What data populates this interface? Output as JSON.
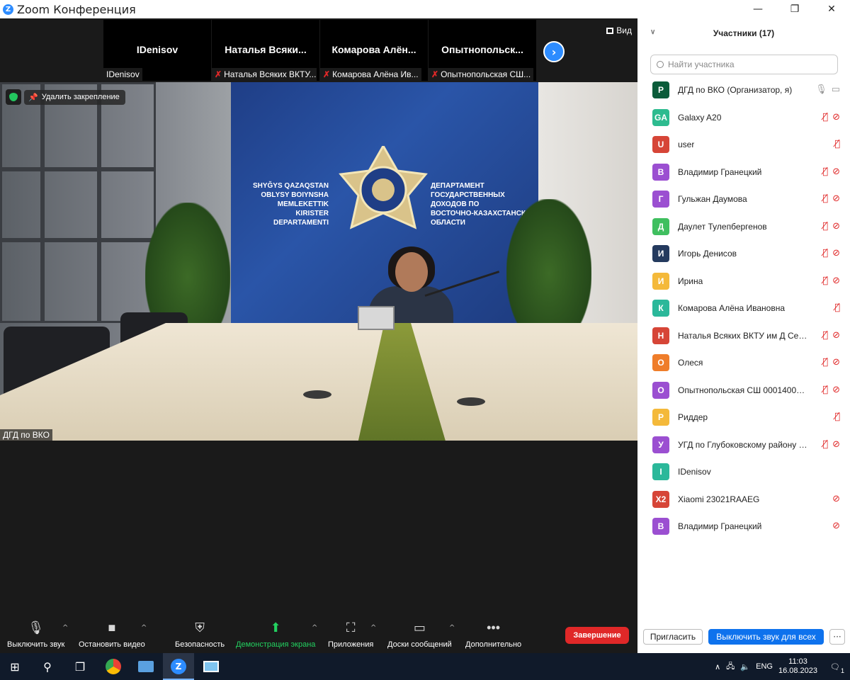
{
  "window": {
    "title": "Zoom Конференция",
    "controls": [
      "—",
      "❐",
      "✕"
    ]
  },
  "strip": {
    "tiles": [
      {
        "name": "IDenisov",
        "label": "IDenisov",
        "muted": false
      },
      {
        "name": "Наталья  Всяки...",
        "label": "Наталья Всяких ВКТУ...",
        "muted": true
      },
      {
        "name": "Комарова  Алён...",
        "label": "Комарова Алёна Ив...",
        "muted": true
      },
      {
        "name": "Опытнопольск...",
        "label": "Опытнопольская СШ...",
        "muted": true
      }
    ],
    "view_label": "Вид"
  },
  "main_video": {
    "unpin_label": "Удалить закрепление",
    "speaker_label": "ДГД по ВКО",
    "wall_text_left": [
      "SHYĞYS QAZAQSTAN",
      "OBLYSY BOIYNSHA",
      "MEMLEKETTIK",
      "KIRISTER",
      "DEPARTAMENTI"
    ],
    "wall_text_right": [
      "ДЕПАРТАМЕНТ",
      "ГОСУДАРСТВЕННЫХ",
      "ДОХОДОВ ПО",
      "ВОСТОЧНО-КАЗАХСТАНСКОЙ",
      "ОБЛАСТИ"
    ]
  },
  "toolbar": {
    "mute": "Выключить звук",
    "video": "Остановить видео",
    "security": "Безопасность",
    "share": "Демонстрация экрана",
    "apps": "Приложения",
    "boards": "Доски сообщений",
    "more": "Дополнительно",
    "end": "Завершение"
  },
  "panel": {
    "title": "Участники (17)",
    "search_placeholder": "Найти участника",
    "invite": "Пригласить",
    "mute_all": "Выключить звук для всех",
    "more": "···",
    "participants": [
      {
        "initials": "Р",
        "name": "ДГД по ВКО (Организатор, я)",
        "color": "#0b5c3a",
        "mic": "on",
        "cam": "on"
      },
      {
        "initials": "GA",
        "name": "Galaxy A20",
        "color": "#2dbb8f",
        "mic": "off",
        "cam": "off"
      },
      {
        "initials": "U",
        "name": "user",
        "color": "#d64537",
        "mic": "off",
        "cam": "none"
      },
      {
        "initials": "В",
        "name": "Владимир Гранецкий",
        "color": "#9b4fd1",
        "mic": "off",
        "cam": "off"
      },
      {
        "initials": "Г",
        "name": "Гульжан Даумова",
        "color": "#9b4fd1",
        "mic": "off",
        "cam": "off"
      },
      {
        "initials": "Д",
        "name": "Даулет Тулепбергенов",
        "color": "#3fbf5f",
        "mic": "off",
        "cam": "off"
      },
      {
        "initials": "И",
        "name": "Игорь Денисов",
        "color": "#243a5e",
        "mic": "off",
        "cam": "off"
      },
      {
        "initials": "И",
        "name": "Ирина",
        "color": "#f4b93a",
        "mic": "off",
        "cam": "off"
      },
      {
        "initials": "К",
        "name": "Комарова Алёна Ивановна",
        "color": "#2bb89a",
        "mic": "off",
        "cam": "none"
      },
      {
        "initials": "Н",
        "name": "Наталья Всяких ВКТУ им Д Серикбаева",
        "color": "#d64537",
        "mic": "off",
        "cam": "off"
      },
      {
        "initials": "О",
        "name": "Олеся",
        "color": "#ef7d2a",
        "mic": "off",
        "cam": "off"
      },
      {
        "initials": "О",
        "name": "Опытнопольская СШ 000140000000",
        "color": "#9b4fd1",
        "mic": "off",
        "cam": "off"
      },
      {
        "initials": "Р",
        "name": "Риддер",
        "color": "#f4b93a",
        "mic": "off",
        "cam": "none"
      },
      {
        "initials": "У",
        "name": "УГД по Глубоковскому району ВКО",
        "color": "#9b4fd1",
        "mic": "off",
        "cam": "off"
      },
      {
        "initials": "I",
        "name": "IDenisov",
        "color": "#2bb89a",
        "mic": "none",
        "cam": "none"
      },
      {
        "initials": "X2",
        "name": "Xiaomi 23021RAAEG",
        "color": "#d64537",
        "mic": "none",
        "cam": "off"
      },
      {
        "initials": "В",
        "name": "Владимир Гранецкий",
        "color": "#9b4fd1",
        "mic": "none",
        "cam": "off"
      }
    ]
  },
  "taskbar": {
    "lang": "ENG",
    "time": "11:03",
    "date": "16.08.2023",
    "notifications": "1"
  }
}
